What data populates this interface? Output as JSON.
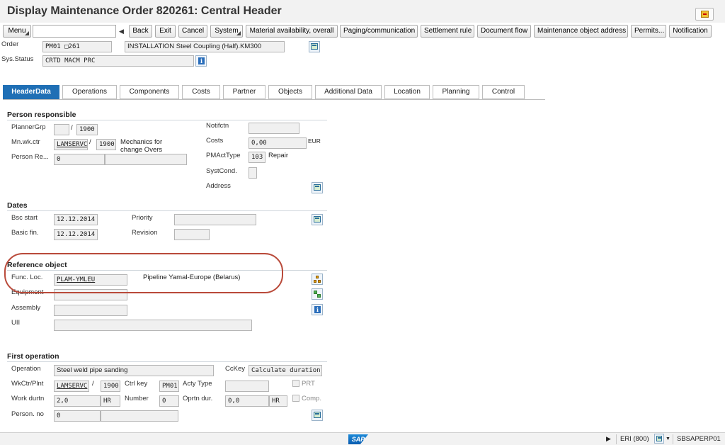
{
  "window": {
    "title": "Display Maintenance Order 820261: Central Header"
  },
  "toolbar": {
    "menu": "Menu",
    "back": "Back",
    "exit": "Exit",
    "cancel": "Cancel",
    "system": "System",
    "material_availability": "Material availability, overall",
    "paging": "Paging/communication",
    "settlement": "Settlement rule",
    "document_flow": "Document flow",
    "maintenance_object_address": "Maintenance object address",
    "permits": "Permits...",
    "notification": "Notification",
    "command_field": ""
  },
  "header": {
    "order_label": "Order",
    "order_type": "PM01",
    "order_number": "□261",
    "order_text": "INSTALLATION Steel Coupling (Half).KM300",
    "sys_status_label": "Sys.Status",
    "sys_status": "CRTD MACM PRC"
  },
  "tabs": [
    {
      "label": "HeaderData",
      "active": true
    },
    {
      "label": "Operations"
    },
    {
      "label": "Components"
    },
    {
      "label": "Costs"
    },
    {
      "label": "Partner"
    },
    {
      "label": "Objects"
    },
    {
      "label": "Additional Data"
    },
    {
      "label": "Location"
    },
    {
      "label": "Planning"
    },
    {
      "label": "Control"
    }
  ],
  "person_responsible": {
    "title": "Person responsible",
    "planner_grp_label": "PlannerGrp",
    "planner_grp": "",
    "planner_plant": "1900",
    "mn_wk_ctr_label": "Mn.wk.ctr",
    "mn_wk_ctr": "LAMSERVC",
    "mn_wk_ctr_plant": "1900",
    "mn_wk_ctr_text_1": "Mechanics for",
    "mn_wk_ctr_text_2": "change Overs",
    "person_resp_label": "Person Re...",
    "person_resp": "0",
    "person_resp_name": "",
    "notifctn_label": "Notifctn",
    "notifctn": "",
    "costs_label": "Costs",
    "costs": "0,00",
    "currency": "EUR",
    "pmacttype_label": "PMActType",
    "pmacttype": "103",
    "pmacttype_text": "Repair",
    "systcond_label": "SystCond.",
    "systcond": "",
    "address_label": "Address",
    "slash": "/"
  },
  "dates": {
    "title": "Dates",
    "bsc_start_label": "Bsc start",
    "bsc_start": "12.12.2014",
    "basic_fin_label": "Basic fin.",
    "basic_fin": "12.12.2014",
    "priority_label": "Priority",
    "priority": "",
    "revision_label": "Revision",
    "revision": ""
  },
  "reference_object": {
    "title": "Reference object",
    "func_loc_label": "Func. Loc.",
    "func_loc": "PLAM-YMLEU",
    "func_loc_text": "Pipeline Yamal-Europe (Belarus)",
    "equipment_label": "Equipment",
    "equipment": "",
    "assembly_label": "Assembly",
    "assembly": "",
    "uii_label": "UII",
    "uii": ""
  },
  "first_operation": {
    "title": "First operation",
    "operation_label": "Operation",
    "operation": "Steel weld pipe sanding",
    "cckey_label": "CcKey",
    "cckey": "Calculate duration",
    "wkctr_label": "WkCtr/Plnt",
    "wkctr": "LAMSERVC",
    "wkctr_plant": "1900",
    "ctrl_key_label": "Ctrl key",
    "ctrl_key": "PM01",
    "acty_type_label": "Acty Type",
    "acty_type": "",
    "prt_label": "PRT",
    "work_durtn_label": "Work durtn",
    "work_durtn": "2,0",
    "work_unit": "HR",
    "number_label": "Number",
    "number": "0",
    "oprtn_dur_label": "Oprtn dur.",
    "oprtn_dur": "0,0",
    "oprtn_unit": "HR",
    "comp_label": "Comp.",
    "person_no_label": "Person. no",
    "person_no": "0",
    "person_no_name": "",
    "slash": "/"
  },
  "statusbar": {
    "system": "ERI (800)",
    "server": "SBSAPERP01",
    "logo": "SAP"
  }
}
